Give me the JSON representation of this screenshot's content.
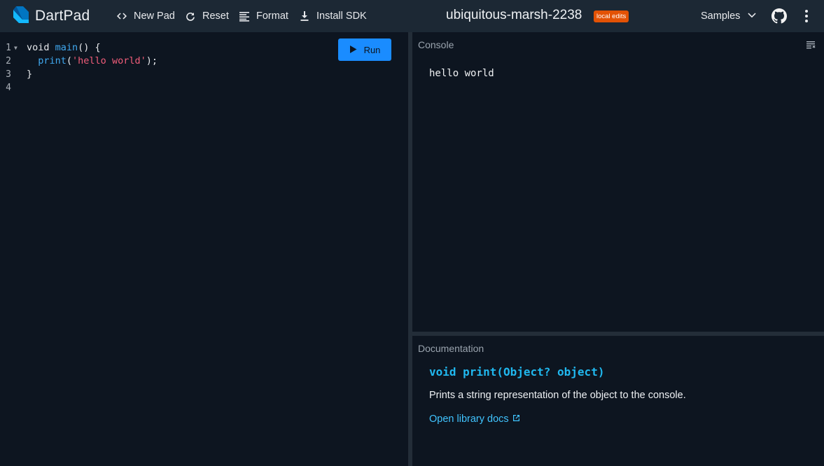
{
  "app": {
    "name": "DartPad"
  },
  "toolbar": {
    "new_pad": "New Pad",
    "reset": "Reset",
    "format": "Format",
    "install_sdk": "Install SDK"
  },
  "pad": {
    "title": "ubiquitous-marsh-2238",
    "badge": "local edits"
  },
  "header_right": {
    "samples": "Samples"
  },
  "editor": {
    "line_numbers": [
      "1",
      "2",
      "3",
      "4"
    ],
    "lines": [
      {
        "a": "void ",
        "b": "main",
        "c": "() {"
      },
      {
        "a": "  ",
        "b": "print",
        "c": "(",
        "s": "'hello world'",
        "d": ");"
      },
      {
        "a": "}"
      },
      {
        "a": ""
      }
    ],
    "run_label": "Run"
  },
  "console": {
    "label": "Console",
    "output": "hello world"
  },
  "docs": {
    "label": "Documentation",
    "signature": "void print(Object? object)",
    "description": "Prints a string representation of the object to the console.",
    "link": "Open library docs"
  },
  "colors": {
    "accent": "#1a8cff",
    "badge": "#e35205",
    "function": "#40a9f0",
    "string": "#f25d7a",
    "doc_signature": "#20b8ef",
    "link": "#40c4ff"
  },
  "icons": [
    "dart-logo-icon",
    "code-icon",
    "refresh-icon",
    "format-lines-icon",
    "download-icon",
    "chevron-down-icon",
    "github-icon",
    "more-vert-icon",
    "play-icon",
    "clear-console-icon",
    "external-link-icon"
  ]
}
